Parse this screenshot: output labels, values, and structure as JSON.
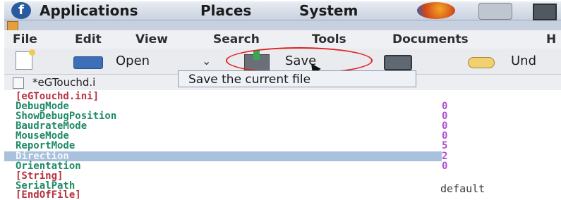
{
  "panel": {
    "menus": [
      "Applications",
      "Places",
      "System"
    ],
    "icons": [
      "distro-logo-icon",
      "firefox-icon",
      "camera-icon",
      "panel-square-icon"
    ]
  },
  "menubar": [
    "File",
    "Edit",
    "View",
    "Search",
    "Tools",
    "Documents",
    "H"
  ],
  "toolbar": {
    "open_label": "Open",
    "save_label": "Save",
    "undo_label": "Und",
    "highlight_color": "#e02020"
  },
  "tab": {
    "label": "*eGTouchd.i"
  },
  "tooltip": {
    "text": "Save the current file"
  },
  "editor": {
    "lines": [
      {
        "text": "[eGTouchd.ini]",
        "kind": "section"
      },
      {
        "text": "DebugMode",
        "kind": "key",
        "value": "0"
      },
      {
        "text": "ShowDebugPosition",
        "kind": "key",
        "value": "0"
      },
      {
        "text": "BaudrateMode",
        "kind": "key",
        "value": "0"
      },
      {
        "text": "MouseMode",
        "kind": "key",
        "value": "0"
      },
      {
        "text": "ReportMode",
        "kind": "key",
        "value": "5"
      },
      {
        "text": "Direction",
        "kind": "key",
        "value": "2",
        "selected": true
      },
      {
        "text": "Orientation",
        "kind": "key",
        "value": "0"
      },
      {
        "text": "[String]",
        "kind": "section"
      },
      {
        "text": "SerialPath",
        "kind": "key",
        "value": "default"
      },
      {
        "text": "[EndOfFile]",
        "kind": "section"
      }
    ]
  },
  "colors": {
    "section": "#b5323e",
    "key": "#1e8a66",
    "number": "#b04fd0",
    "selection": "#a9c1dd"
  }
}
